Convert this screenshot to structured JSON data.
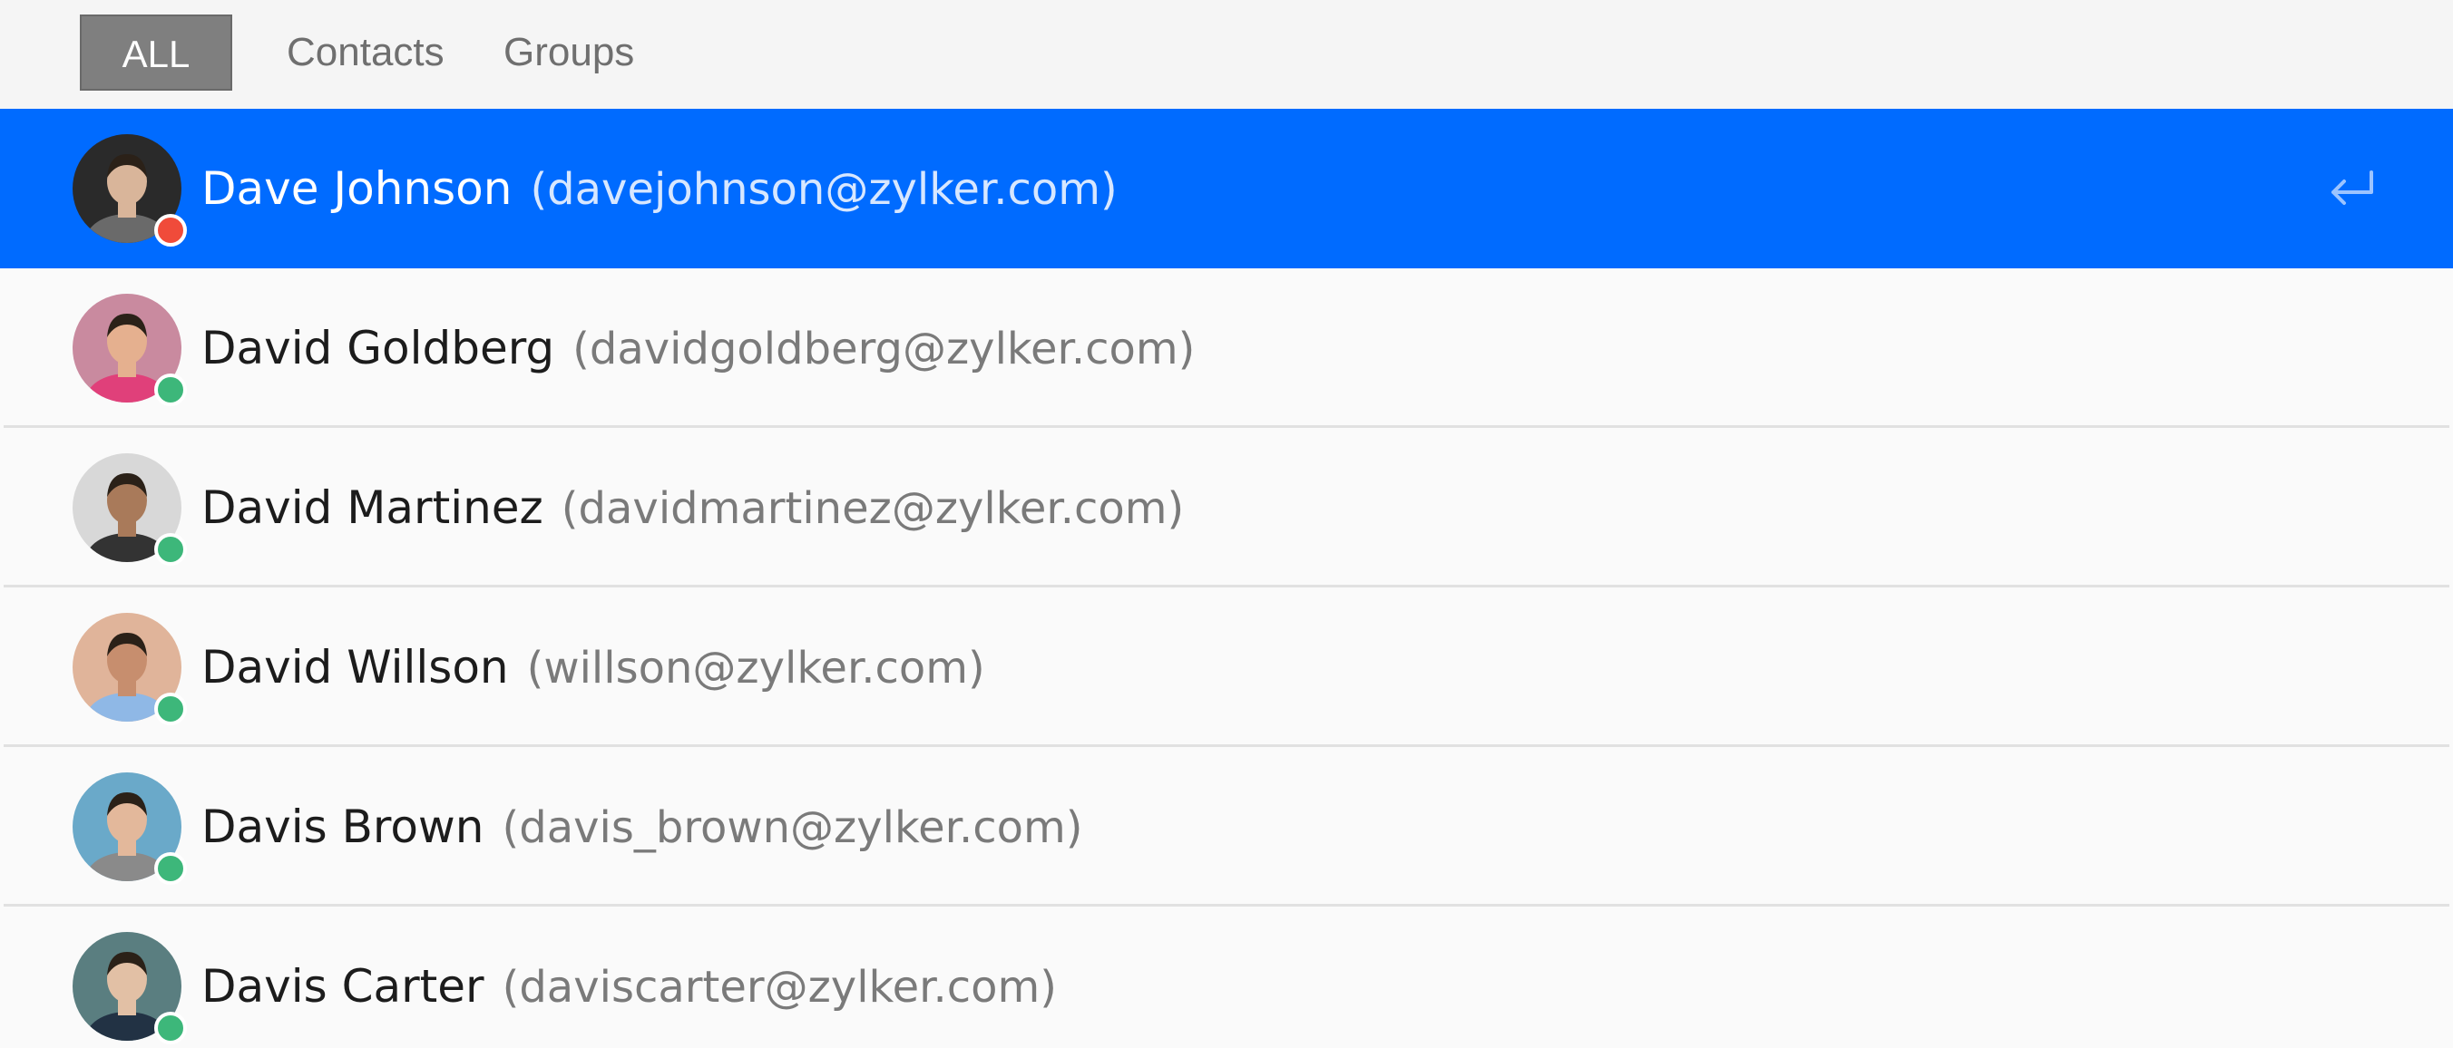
{
  "tabs": [
    {
      "label": "ALL",
      "active": true
    },
    {
      "label": "Contacts",
      "active": false
    },
    {
      "label": "Groups",
      "active": false
    }
  ],
  "contacts": [
    {
      "name": "Dave Johnson",
      "email": "(davejohnson@zylker.com)",
      "status": "busy",
      "status_color": "#f04b3a",
      "selected": true,
      "avatar_colors": [
        "#2a2a2a",
        "#d9b59a",
        "#6a6a6a"
      ]
    },
    {
      "name": "David Goldberg",
      "email": "(davidgoldberg@zylker.com)",
      "status": "online",
      "status_color": "#3db77a",
      "selected": false,
      "avatar_colors": [
        "#c98a9f",
        "#e5b08f",
        "#e0407a"
      ]
    },
    {
      "name": "David Martinez",
      "email": "(davidmartinez@zylker.com)",
      "status": "online",
      "status_color": "#3db77a",
      "selected": false,
      "avatar_colors": [
        "#d8d8d8",
        "#a97a5a",
        "#333333"
      ]
    },
    {
      "name": "David Willson",
      "email": "(willson@zylker.com)",
      "status": "online",
      "status_color": "#3db77a",
      "selected": false,
      "avatar_colors": [
        "#e0b49a",
        "#c78e6e",
        "#8fb8e6"
      ]
    },
    {
      "name": "Davis Brown",
      "email": "(davis_brown@zylker.com)",
      "status": "online",
      "status_color": "#3db77a",
      "selected": false,
      "avatar_colors": [
        "#6aa9c9",
        "#e3b89b",
        "#8a8a8a"
      ]
    },
    {
      "name": "Davis Carter",
      "email": "(daviscarter@zylker.com)",
      "status": "online",
      "status_color": "#3db77a",
      "selected": false,
      "avatar_colors": [
        "#5a7e80",
        "#e2c0a5",
        "#223244"
      ]
    }
  ],
  "icons": {
    "enter": "enter-arrow-icon"
  },
  "colors": {
    "accent": "#006bff",
    "tab_active_bg": "#7f7f7f",
    "online": "#3db77a",
    "busy": "#f04b3a"
  }
}
